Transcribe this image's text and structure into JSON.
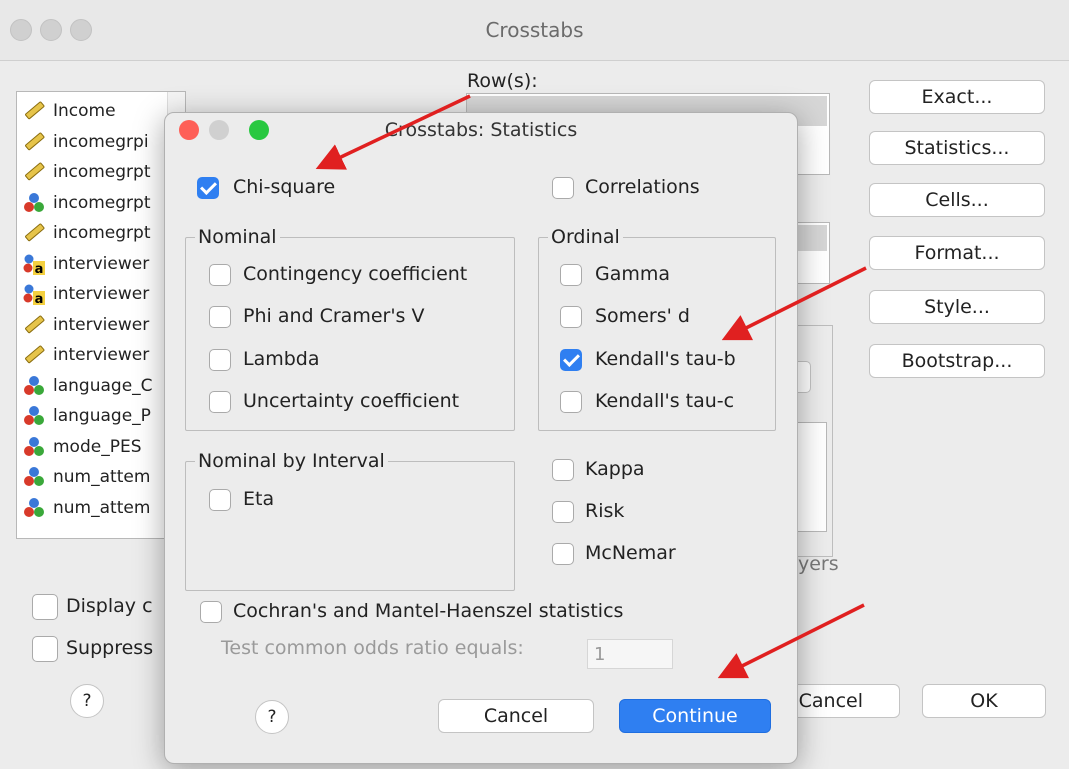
{
  "outer": {
    "title": "Crosstabs",
    "rows_label": "Row(s):",
    "layers_fragment": "yers",
    "buttons": {
      "exact": "Exact...",
      "statistics": "Statistics...",
      "cells": "Cells...",
      "format": "Format...",
      "style": "Style...",
      "bootstrap": "Bootstrap...",
      "cancel": "Cancel",
      "ok": "OK",
      "help": "?"
    },
    "checks": {
      "display": "Display c",
      "suppress": "Suppress"
    },
    "variables": [
      {
        "name": "Income",
        "icon": "scale-ruler-icon"
      },
      {
        "name": "incomegrpi",
        "icon": "scale-ruler-icon"
      },
      {
        "name": "incomegrpt",
        "icon": "scale-ruler-icon"
      },
      {
        "name": "incomegrpt",
        "icon": "nominal-balls-icon"
      },
      {
        "name": "incomegrpt",
        "icon": "scale-ruler-icon"
      },
      {
        "name": "interviewer",
        "icon": "string-a-icon"
      },
      {
        "name": "interviewer",
        "icon": "string-a-icon"
      },
      {
        "name": "interviewer",
        "icon": "scale-ruler-icon"
      },
      {
        "name": "interviewer",
        "icon": "scale-ruler-icon"
      },
      {
        "name": "language_C",
        "icon": "nominal-balls-icon"
      },
      {
        "name": "language_P",
        "icon": "nominal-balls-icon"
      },
      {
        "name": "mode_PES",
        "icon": "nominal-balls-icon"
      },
      {
        "name": "num_attem",
        "icon": "nominal-balls-icon"
      },
      {
        "name": "num_attem",
        "icon": "nominal-balls-icon"
      }
    ]
  },
  "dialog": {
    "title": "Crosstabs: Statistics",
    "chi_square": {
      "label": "Chi-square",
      "checked": true
    },
    "correlations": {
      "label": "Correlations",
      "checked": false
    },
    "nominal": {
      "title": "Nominal",
      "items": [
        {
          "label": "Contingency coefficient",
          "checked": false
        },
        {
          "label": "Phi and Cramer's V",
          "checked": false
        },
        {
          "label": "Lambda",
          "checked": false
        },
        {
          "label": "Uncertainty coefficient",
          "checked": false
        }
      ]
    },
    "ordinal": {
      "title": "Ordinal",
      "items": [
        {
          "label": "Gamma",
          "checked": false
        },
        {
          "label": "Somers' d",
          "checked": false
        },
        {
          "label": "Kendall's tau-b",
          "checked": true
        },
        {
          "label": "Kendall's tau-c",
          "checked": false
        }
      ]
    },
    "nominal_interval": {
      "title": "Nominal by Interval",
      "items": [
        {
          "label": "Eta",
          "checked": false
        }
      ]
    },
    "other": [
      {
        "label": "Kappa",
        "checked": false
      },
      {
        "label": "Risk",
        "checked": false
      },
      {
        "label": "McNemar",
        "checked": false
      }
    ],
    "cochran": {
      "label": "Cochran's and Mantel-Haenszel statistics",
      "checked": false
    },
    "odds_label": "Test common odds ratio equals:",
    "odds_value": "1",
    "help": "?",
    "cancel": "Cancel",
    "continue": "Continue",
    "colors": {
      "accent": "#2f7ff1",
      "arrow": "#e02020",
      "close": "#fe5f57",
      "minimize": "#febc2e",
      "zoom": "#28c840"
    }
  }
}
